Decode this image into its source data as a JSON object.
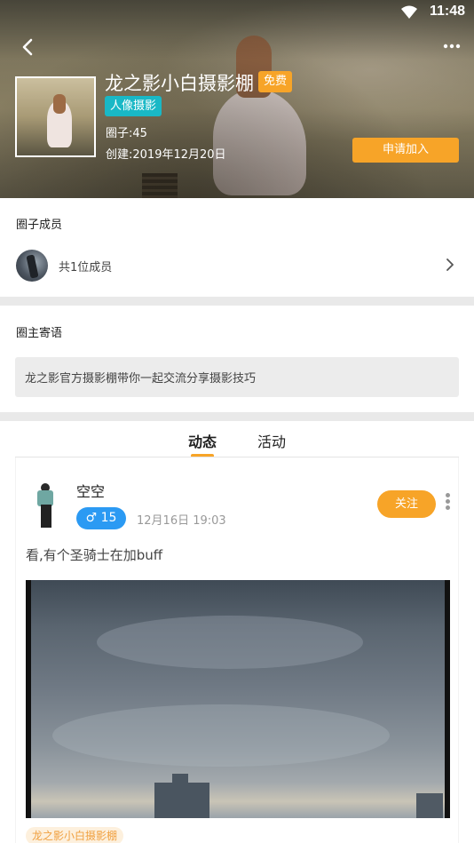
{
  "status_bar": {
    "time": "11:48",
    "wifi_icon": "wifi-icon"
  },
  "header": {
    "back_icon": "back-arrow-icon",
    "more_icon": "more-dots-icon",
    "circle_title": "龙之影小白摄影棚",
    "free_badge": "免费",
    "category_tag": "人像摄影",
    "members_count": "圈子:45",
    "created_date": "创建:2019年12月20日",
    "join_button": "申请加入"
  },
  "members_section": {
    "title": "圈子成员",
    "total_text": "共1位成员",
    "chevron_icon": "chevron-right-icon"
  },
  "owner_message": {
    "title": "圈主寄语",
    "text": "龙之影官方摄影棚带你一起交流分享摄影技巧"
  },
  "tabs": [
    {
      "label": "动态",
      "active": true
    },
    {
      "label": "活动",
      "active": false
    }
  ],
  "post": {
    "username": "空空",
    "gender_symbol": "♂",
    "level": "15",
    "gender_level_text": "♂ 15",
    "time": "12月16日 19:03",
    "follow_button": "关注",
    "text": "看,有个圣骑士在加buff",
    "circle_tag": "龙之影小白摄影棚"
  },
  "colors": {
    "accent_orange": "#f7a428",
    "tag_teal": "#19b8c6",
    "gender_blue": "#2b9af3",
    "divider_gray": "#e9e9e9"
  }
}
